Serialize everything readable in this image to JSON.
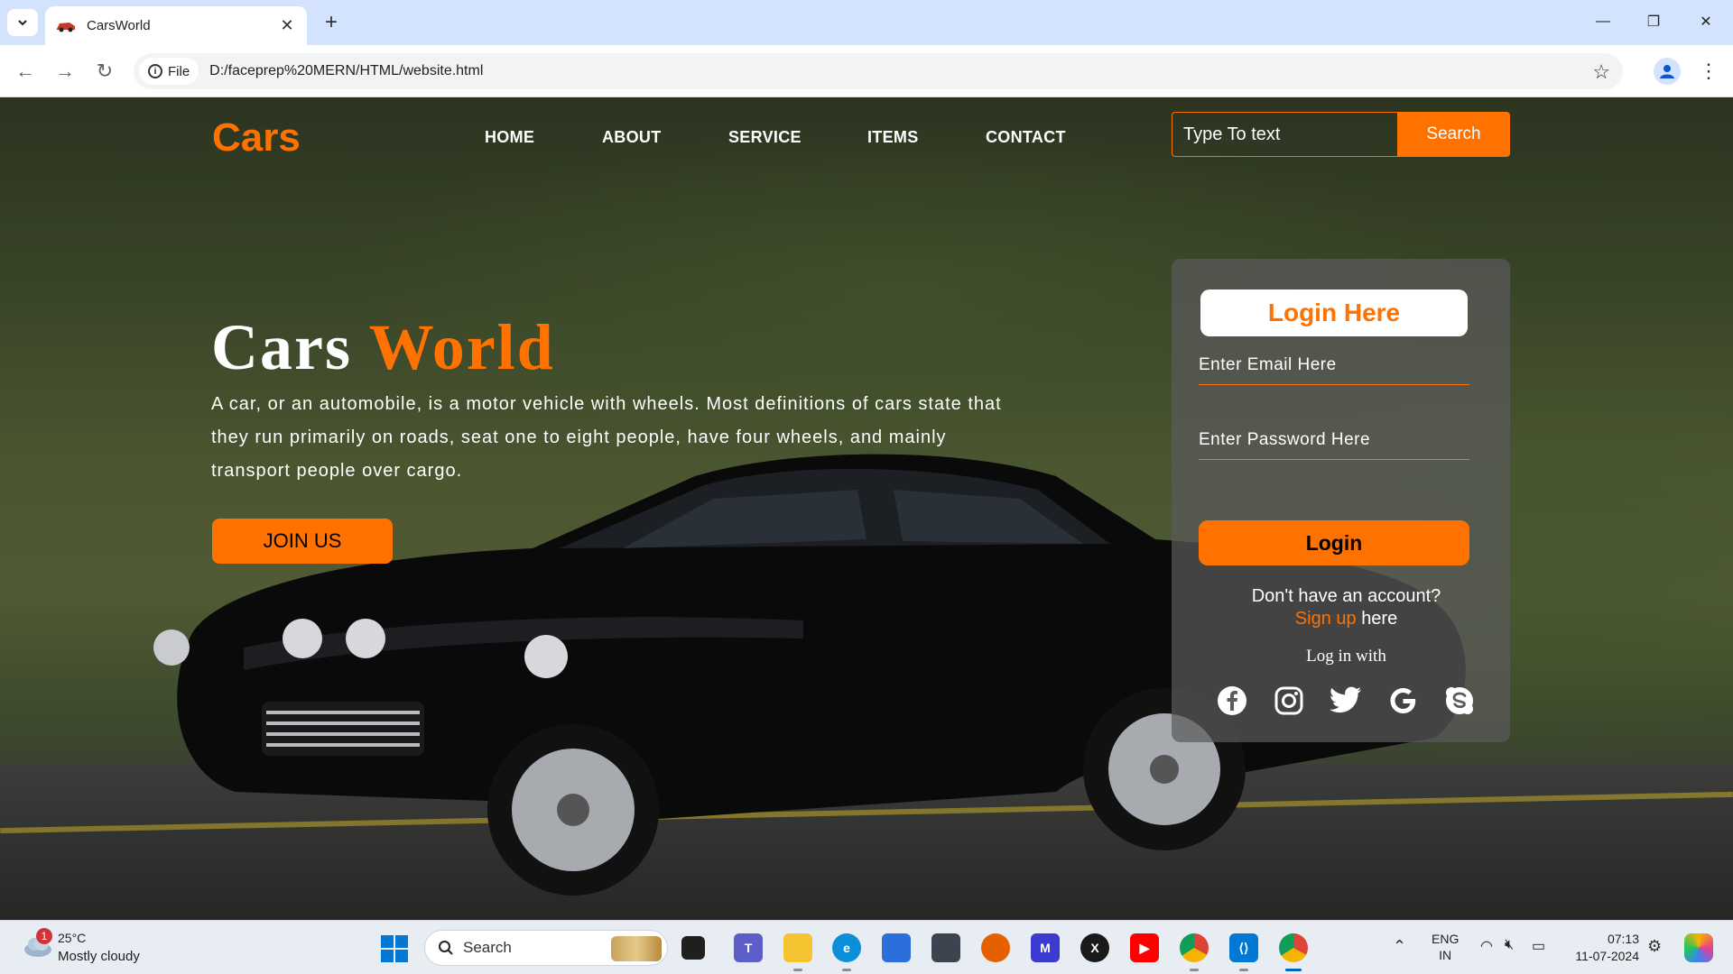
{
  "browser": {
    "tab_title": "CarsWorld",
    "url": "D:/faceprep%20MERN/HTML/website.html",
    "site_chip_label": "File",
    "icons": [
      "tab-list-icon",
      "close-icon",
      "plus-icon",
      "minimize-icon",
      "restore-icon",
      "window-close-icon",
      "back-icon",
      "forward-icon",
      "reload-icon",
      "info-icon",
      "star-icon",
      "profile-icon",
      "kebab-menu-icon"
    ]
  },
  "site": {
    "brand": "Cars",
    "nav": [
      "HOME",
      "ABOUT",
      "SERVICE",
      "ITEMS",
      "CONTACT"
    ],
    "search": {
      "placeholder": "Type To text",
      "button": "Search"
    },
    "hero": {
      "title_part1": "Cars",
      "title_part2": "World",
      "text": "A car, or an automobile, is a motor vehicle with wheels. Most definitions of cars state that they run primarily on roads, seat one to eight people, have four wheels, and mainly transport people over cargo.",
      "join_button": "JOIN US"
    },
    "login": {
      "title": "Login Here",
      "email_placeholder": "Enter Email Here",
      "password_placeholder": "Enter Password Here",
      "button": "Login",
      "no_account": "Don't have an account?",
      "signup_link": "Sign up",
      "signup_suffix": "here",
      "login_with": "Log in with",
      "socials": [
        "facebook-icon",
        "instagram-icon",
        "twitter-icon",
        "google-icon",
        "skype-icon"
      ]
    },
    "colors": {
      "accent": "#ff7200",
      "card": "#5a5a5a"
    }
  },
  "taskbar": {
    "weather_temp": "25°C",
    "weather_desc": "Mostly cloudy",
    "weather_badge": "1",
    "search_label": "Search",
    "lang_line1": "ENG",
    "lang_line2": "IN",
    "time": "07:13",
    "date": "11-07-2024",
    "apps": [
      "start-icon",
      "task-view-icon",
      "teams-icon",
      "file-explorer-icon",
      "edge-icon",
      "store-icon",
      "app-icon",
      "firefox-icon",
      "app-icon",
      "xbox-icon",
      "youtube-icon",
      "chrome-icon",
      "vscode-icon",
      "chrome-icon"
    ]
  }
}
